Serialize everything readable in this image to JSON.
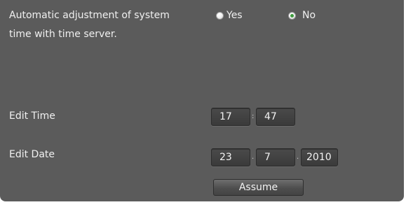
{
  "auto_adjust": {
    "label_line1": "Automatic adjustment of system",
    "label_line2": "time with time server.",
    "options": [
      {
        "label": "Yes",
        "selected": false
      },
      {
        "label": "No",
        "selected": true
      }
    ]
  },
  "edit_time": {
    "label": "Edit Time",
    "hour": "17",
    "minute": "47"
  },
  "edit_date": {
    "label": "Edit Date",
    "day": "23",
    "month": "7",
    "year": "2010"
  },
  "assume_button": {
    "label": "Assume"
  },
  "colors": {
    "panel_background": "#5b5b5b",
    "field_background": "#3f3f3f",
    "radio_selected": "#3e9b3e"
  }
}
